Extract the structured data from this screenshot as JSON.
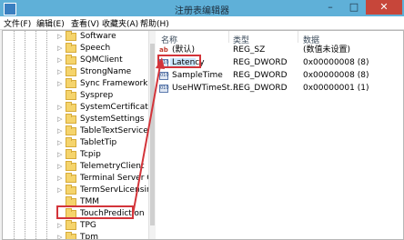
{
  "window": {
    "title": "注册表编辑器",
    "minimize_glyph": "–",
    "maximize_glyph": "□",
    "close_glyph": "✕"
  },
  "menu": [
    "文件(F)",
    "编辑(E)",
    "查看(V)",
    "收藏夹(A)",
    "帮助(H)"
  ],
  "tree": {
    "items": [
      {
        "label": "Software"
      },
      {
        "label": "Speech"
      },
      {
        "label": "SQMClient"
      },
      {
        "label": "StrongName"
      },
      {
        "label": "Sync Framework"
      },
      {
        "label": "Sysprep"
      },
      {
        "label": "SystemCertificates"
      },
      {
        "label": "SystemSettings"
      },
      {
        "label": "TableTextService"
      },
      {
        "label": "TabletTip"
      },
      {
        "label": "Tcpip"
      },
      {
        "label": "TelemetryClient"
      },
      {
        "label": "Terminal Server Clie"
      },
      {
        "label": "TermServLicensing"
      },
      {
        "label": "TMM"
      },
      {
        "label": "TouchPrediction"
      },
      {
        "label": "TPG"
      },
      {
        "label": "Tpm"
      }
    ],
    "selected": "TouchPrediction"
  },
  "list": {
    "columns": {
      "name": "名称",
      "type": "类型",
      "data": "数据"
    },
    "rows": [
      {
        "name": "(默认)",
        "type": "REG_SZ",
        "data": "(数值未设置)",
        "icon": "string-value-icon"
      },
      {
        "name": "Latency",
        "type": "REG_DWORD",
        "data": "0x00000008 (8)",
        "icon": "binary-value-icon"
      },
      {
        "name": "SampleTime",
        "type": "REG_DWORD",
        "data": "0x00000008 (8)",
        "icon": "binary-value-icon"
      },
      {
        "name": "UseHWTimeSt...",
        "type": "REG_DWORD",
        "data": "0x00000001 (1)",
        "icon": "binary-value-icon"
      }
    ]
  },
  "colors": {
    "titlebar": "#5fb0d8",
    "highlight": "#d3343a",
    "close": "#c7463a"
  }
}
